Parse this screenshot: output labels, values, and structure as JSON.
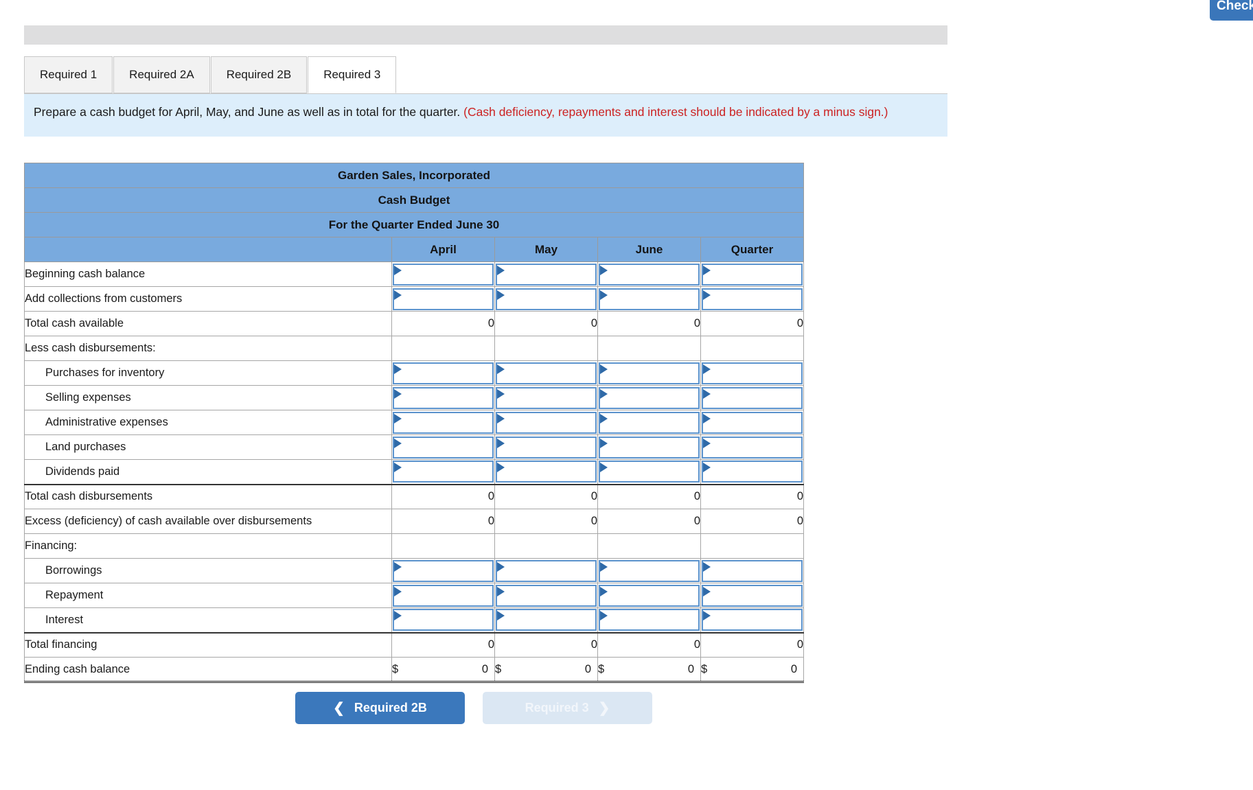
{
  "check_button": {
    "label": "Check"
  },
  "tabs": [
    {
      "label": "Required 1",
      "active": false
    },
    {
      "label": "Required 2A",
      "active": false
    },
    {
      "label": "Required 2B",
      "active": false
    },
    {
      "label": "Required 3",
      "active": true
    }
  ],
  "instruction": {
    "main": "Prepare a cash budget for April, May, and June as well as in total for the quarter.",
    "hint": "(Cash deficiency, repayments and interest should be indicated by a minus sign.)"
  },
  "table": {
    "company": "Garden Sales, Incorporated",
    "statement": "Cash Budget",
    "period": "For the Quarter Ended June 30",
    "columns": [
      "",
      "April",
      "May",
      "June",
      "Quarter"
    ],
    "rows": [
      {
        "label": "Beginning cash balance",
        "indent": false,
        "type": "input",
        "values": [
          "",
          "",
          "",
          ""
        ]
      },
      {
        "label": "Add collections from customers",
        "indent": false,
        "type": "input",
        "values": [
          "",
          "",
          "",
          ""
        ]
      },
      {
        "label": "Total cash available",
        "indent": false,
        "type": "value",
        "values": [
          "0",
          "0",
          "0",
          "0"
        ]
      },
      {
        "label": "Less cash disbursements:",
        "indent": false,
        "type": "blank",
        "values": [
          "",
          "",
          "",
          ""
        ]
      },
      {
        "label": "Purchases for inventory",
        "indent": true,
        "type": "input",
        "values": [
          "",
          "",
          "",
          ""
        ]
      },
      {
        "label": "Selling expenses",
        "indent": true,
        "type": "input",
        "values": [
          "",
          "",
          "",
          ""
        ]
      },
      {
        "label": "Administrative expenses",
        "indent": true,
        "type": "input",
        "values": [
          "",
          "",
          "",
          ""
        ]
      },
      {
        "label": "Land purchases",
        "indent": true,
        "type": "input",
        "values": [
          "",
          "",
          "",
          ""
        ]
      },
      {
        "label": "Dividends paid",
        "indent": true,
        "type": "input",
        "values": [
          "",
          "",
          "",
          ""
        ]
      },
      {
        "label": "Total cash disbursements",
        "indent": false,
        "type": "value",
        "values": [
          "0",
          "0",
          "0",
          "0"
        ]
      },
      {
        "label": "Excess (deficiency) of cash available over disbursements",
        "indent": false,
        "type": "value",
        "values": [
          "0",
          "0",
          "0",
          "0"
        ]
      },
      {
        "label": "Financing:",
        "indent": false,
        "type": "blank",
        "values": [
          "",
          "",
          "",
          ""
        ]
      },
      {
        "label": "Borrowings",
        "indent": true,
        "type": "input",
        "values": [
          "",
          "",
          "",
          ""
        ]
      },
      {
        "label": "Repayment",
        "indent": true,
        "type": "input",
        "values": [
          "",
          "",
          "",
          ""
        ]
      },
      {
        "label": "Interest",
        "indent": true,
        "type": "input",
        "values": [
          "",
          "",
          "",
          ""
        ]
      },
      {
        "label": "Total financing",
        "indent": false,
        "type": "value",
        "values": [
          "0",
          "0",
          "0",
          "0"
        ]
      },
      {
        "label": "Ending cash balance",
        "indent": false,
        "type": "money",
        "currency": "$",
        "values": [
          "0",
          "0",
          "0",
          "0"
        ]
      }
    ]
  },
  "nav": {
    "prev_label": "Required 2B",
    "next_label": "Required 3",
    "prev_icon": "chevron-left-icon",
    "next_icon": "chevron-right-icon"
  },
  "colors": {
    "table_header_blue": "#79aade",
    "instruction_bg": "#ddeefb",
    "hint_red": "#cc2222",
    "button_blue": "#3b78bc",
    "button_disabled": "#dbe7f3",
    "input_border": "#5b93cd",
    "input_marker": "#2f6aa8"
  }
}
